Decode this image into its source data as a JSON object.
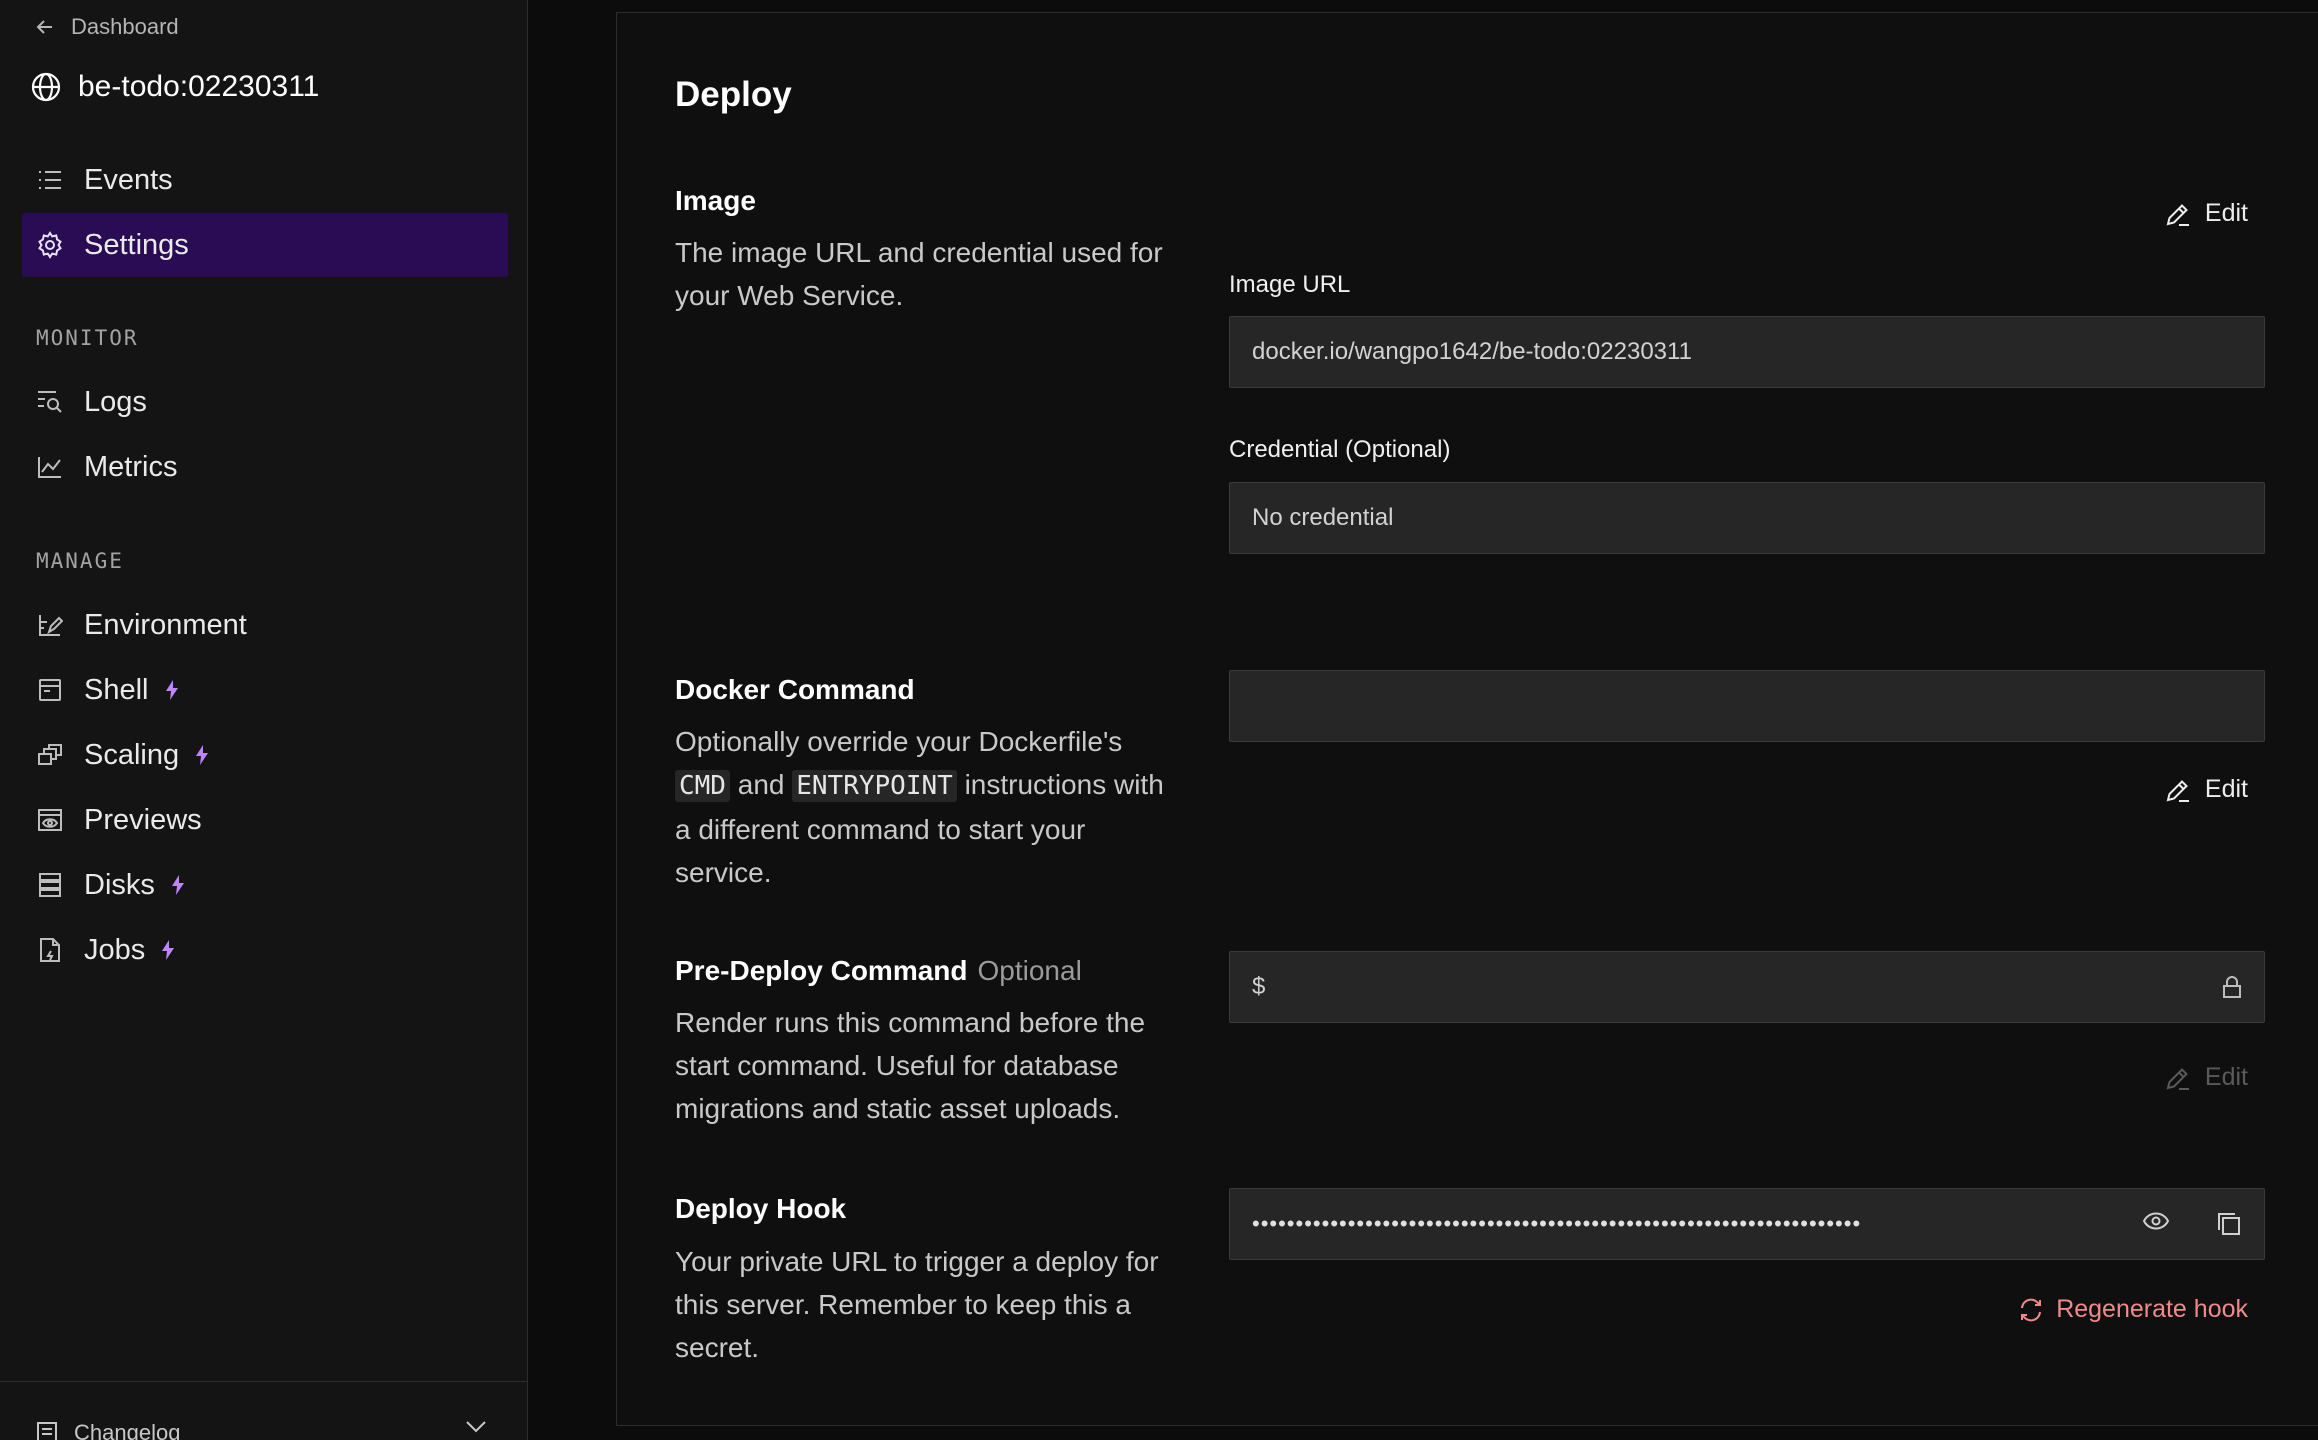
{
  "sidebar": {
    "back_label": "Dashboard",
    "service_name": "be-todo:02230311",
    "top_items": [
      {
        "label": "Events",
        "icon": "list-icon"
      },
      {
        "label": "Settings",
        "icon": "gear-icon",
        "active": true
      }
    ],
    "monitor_label": "MONITOR",
    "monitor_items": [
      {
        "label": "Logs",
        "icon": "logs-search-icon"
      },
      {
        "label": "Metrics",
        "icon": "line-chart-icon"
      }
    ],
    "manage_label": "MANAGE",
    "manage_items": [
      {
        "label": "Environment",
        "icon": "environment-icon"
      },
      {
        "label": "Shell",
        "icon": "terminal-icon",
        "upgrade": true
      },
      {
        "label": "Scaling",
        "icon": "scaling-icon",
        "upgrade": true
      },
      {
        "label": "Previews",
        "icon": "preview-icon"
      },
      {
        "label": "Disks",
        "icon": "disk-icon",
        "upgrade": true
      },
      {
        "label": "Jobs",
        "icon": "jobs-icon",
        "upgrade": true
      }
    ],
    "footer_label": "Changelog"
  },
  "main": {
    "title": "Deploy",
    "image": {
      "title": "Image",
      "description": "The image URL and credential used for your Web Service.",
      "edit_label": "Edit",
      "url_label": "Image URL",
      "url_value": "docker.io/wangpo1642/be-todo:02230311",
      "credential_label": "Credential (Optional)",
      "credential_value": "No credential"
    },
    "docker_command": {
      "title": "Docker Command",
      "desc_pre": "Optionally override your Dockerfile's",
      "code_cmd": "CMD",
      "desc_and": "and",
      "code_entrypoint": "ENTRYPOINT",
      "desc_post": "instructions with a different command to start your service.",
      "value": "",
      "edit_label": "Edit"
    },
    "pre_deploy": {
      "title": "Pre-Deploy Command",
      "optional": "Optional",
      "description": "Render runs this command before the start command. Useful for database migrations and static asset uploads.",
      "prefix": "$",
      "edit_label": "Edit"
    },
    "deploy_hook": {
      "title": "Deploy Hook",
      "description": "Your private URL to trigger a deploy for this server. Remember to keep this a secret.",
      "masked_value": "••••••••••••••••••••••••••••••••••••••••••••••••••••••••••••••••••••••",
      "regenerate_label": "Regenerate hook"
    }
  },
  "colors": {
    "active_nav_bg": "#2a0c54",
    "upgrade_bolt": "#c084fc",
    "danger_text": "#f08a8a"
  }
}
